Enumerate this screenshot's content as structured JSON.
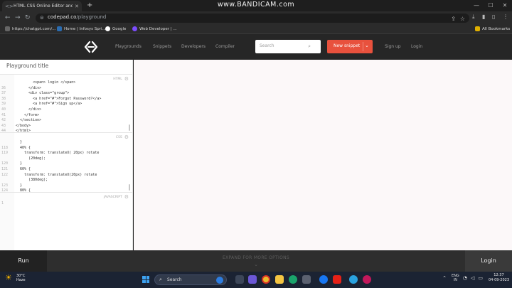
{
  "browser": {
    "tab_title": "HTML CSS Online Editor and Ar",
    "recorder_watermark": "www.BANDICAM.com",
    "url_host": "codepad.co",
    "url_path": "/playground",
    "bookmarks": [
      {
        "label": "https://chatgpt.com/...",
        "color": "#666666"
      },
      {
        "label": "Home | Infosys Spri...",
        "color": "#2b6cb0"
      },
      {
        "label": "Google",
        "color": "#ffffff"
      },
      {
        "label": "Web Developer | ...",
        "color": "#7c4dff"
      }
    ],
    "all_bookmarks": "All Bookmarks"
  },
  "site": {
    "nav": [
      "Playgrounds",
      "Snippets",
      "Developers",
      "Compiler"
    ],
    "search_placeholder": "Search",
    "new_snippet": "New snippet",
    "sign_up": "Sign up",
    "login": "Login"
  },
  "editor": {
    "playground_title": "Playground title",
    "html_label": "HTML",
    "css_label": "CSS",
    "js_label": "JAVASCRIPT",
    "html_lines": [
      {
        "n": "",
        "c": "        <span> login </span>"
      },
      {
        "n": "36",
        "c": "      </div>"
      },
      {
        "n": "37",
        "c": "      <div class=\"group\">"
      },
      {
        "n": "38",
        "c": "        <a href=\"#\">Forgot Password?</a>"
      },
      {
        "n": "39",
        "c": "        <a href=\"#\">Sign up</a>"
      },
      {
        "n": "40",
        "c": "      </div>"
      },
      {
        "n": "41",
        "c": "    </form>"
      },
      {
        "n": "42",
        "c": "  </section>"
      },
      {
        "n": "43",
        "c": "</body>"
      },
      {
        "n": "44",
        "c": "</html>"
      }
    ],
    "css_lines": [
      {
        "n": "",
        "c": "  }"
      },
      {
        "n": "118",
        "c": "  40% {"
      },
      {
        "n": "119",
        "c": "    transform: translateX( 20px) rotate"
      },
      {
        "n": "",
        "c": "      (20deg);"
      },
      {
        "n": "120",
        "c": "  }"
      },
      {
        "n": "121",
        "c": "  60% {"
      },
      {
        "n": "122",
        "c": "    transform: translateX(20px) rotate"
      },
      {
        "n": "",
        "c": "      (380deg);"
      },
      {
        "n": "123",
        "c": "  }"
      },
      {
        "n": "124",
        "c": "  80% {"
      }
    ],
    "js_lines": [
      {
        "n": "1",
        "c": ""
      }
    ]
  },
  "bottom": {
    "run": "Run",
    "expand": "EXPAND FOR MORE OPTIONS",
    "login": "Login"
  },
  "taskbar": {
    "weather_temp": "30°C",
    "weather_desc": "Haze",
    "search": "Search",
    "lang_top": "ENG",
    "lang_bottom": "IN",
    "time": "12:37",
    "date": "04-09-2023"
  }
}
